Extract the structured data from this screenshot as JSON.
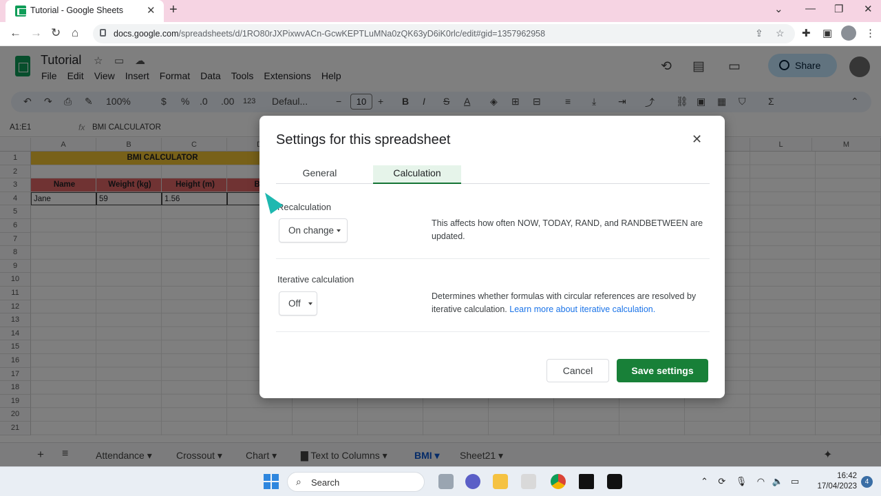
{
  "browser": {
    "tab_title": "Tutorial - Google Sheets",
    "url_host": "docs.google.com",
    "url_path": "/spreadsheets/d/1RO80rJXPixwvACn-GcwKEPTLuMNa0zQK63yD6iK0rlc/edit#gid=1357962958"
  },
  "sheets": {
    "doc_title": "Tutorial",
    "menu": [
      "File",
      "Edit",
      "View",
      "Insert",
      "Format",
      "Data",
      "Tools",
      "Extensions",
      "Help"
    ],
    "share_label": "Share",
    "toolbar": {
      "zoom": "100%",
      "currency": "$",
      "percent": "%",
      "dec_less": ".0",
      "dec_more": ".00",
      "number_format": "123",
      "font": "Defaul...",
      "font_size": "10",
      "bold": "B",
      "italic": "I",
      "strike": "S",
      "text_color": "A",
      "sigma": "Σ"
    },
    "name_box": "A1:E1",
    "formula_text": "BMI CALCULATOR",
    "columns": [
      "A",
      "B",
      "C",
      "D",
      "L",
      "M"
    ],
    "rows": [
      "1",
      "2",
      "3",
      "4",
      "5",
      "6",
      "7",
      "8",
      "9",
      "10",
      "11",
      "12",
      "13",
      "14",
      "15",
      "16",
      "17",
      "18",
      "19",
      "20",
      "21"
    ],
    "cells": {
      "title": "BMI CALCULATOR",
      "h_name": "Name",
      "h_weight": "Weight (kg)",
      "h_height": "Height (m)",
      "h_bmi": "BM",
      "name": "Jane",
      "weight": "59",
      "height": "1.56"
    },
    "sheet_tabs": [
      "Attendance",
      "Crossout",
      "Chart",
      "Text to Columns",
      "BMI",
      "Sheet21"
    ],
    "active_sheet": "BMI"
  },
  "dialog": {
    "title": "Settings for this spreadsheet",
    "tabs": [
      "General",
      "Calculation"
    ],
    "active_tab": "Calculation",
    "recalc_label": "Recalculation",
    "recalc_value": "On change",
    "recalc_desc": "This affects how often NOW, TODAY, RAND, and RANDBETWEEN are updated.",
    "iter_label": "Iterative calculation",
    "iter_value": "Off",
    "iter_desc": "Determines whether formulas with circular references are resolved by iterative calculation.",
    "iter_link": "Learn more about iterative calculation.",
    "cancel_label": "Cancel",
    "save_label": "Save settings"
  },
  "taskbar": {
    "search_label": "Search",
    "time": "16:42",
    "date": "17/04/2023",
    "notification_count": "4"
  },
  "colors": {
    "title_row": "#f1c232",
    "header_row": "#e06666",
    "save_button": "#188038",
    "active_tab_bg": "#e6f4ea"
  }
}
